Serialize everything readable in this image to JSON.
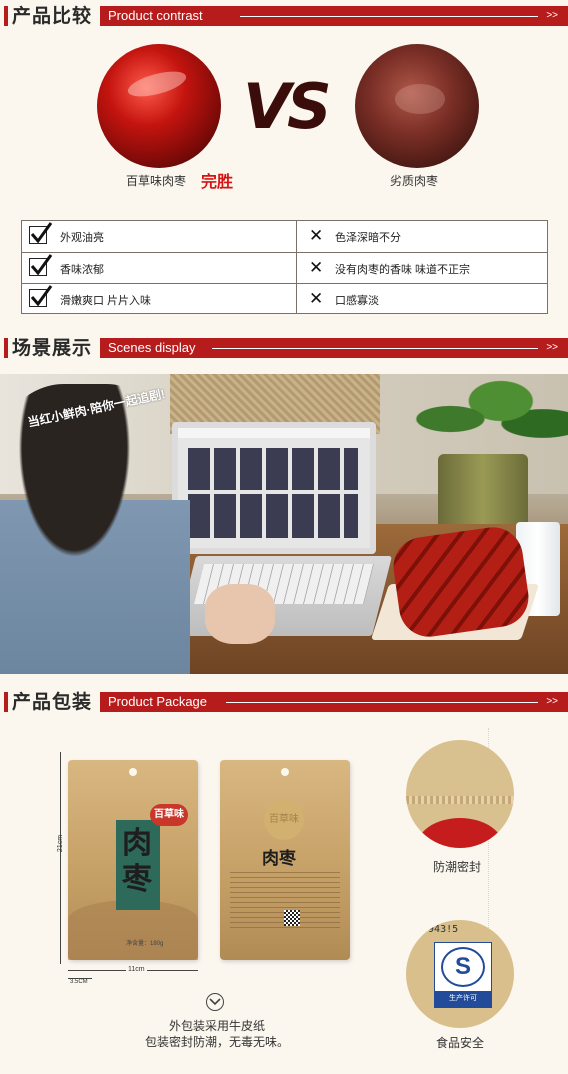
{
  "sections": {
    "compare": {
      "title_cn": "产品比较",
      "title_en": "Product  contrast",
      "arrow": ">>"
    },
    "scene": {
      "title_cn": "场景展示",
      "title_en": "Scenes display",
      "arrow": ">>"
    },
    "package": {
      "title_cn": "产品包装",
      "title_en": "Product Package",
      "arrow": ">>"
    }
  },
  "compare": {
    "vs": "VS",
    "good_label": "百草味肉枣",
    "winner": "完胜",
    "bad_label": "劣质肉枣",
    "rows": [
      {
        "good": "外观油亮",
        "bad": "色泽深暗不分"
      },
      {
        "good": "香味浓郁",
        "bad": "没有肉枣的香味 味道不正宗"
      },
      {
        "good": "滑嫩爽口 片片入味",
        "bad": "口感寡淡"
      }
    ],
    "x_symbol": "✕"
  },
  "scene": {
    "caption": "当红小鲜肉·陪你一起追剧!"
  },
  "package": {
    "front_logo": "百草味",
    "front_title": "肉枣",
    "back_logo": "百草味",
    "back_title": "肉枣",
    "height_label": "21cm",
    "width_label": "11cm",
    "gusset_label": "3.5CM",
    "weight_label": "净含量：180g",
    "zip_label": "防潮密封",
    "qs_code": "5 943!5",
    "qs_letter": "S",
    "qs_text": "生产许可",
    "safety_label": "食品安全",
    "note_line1": "外包装采用牛皮纸",
    "note_line2": "包装密封防潮，无毒无味。"
  },
  "colors": {
    "accent": "#b71c1c",
    "winner": "#d41414",
    "background": "#fbf6ee"
  }
}
